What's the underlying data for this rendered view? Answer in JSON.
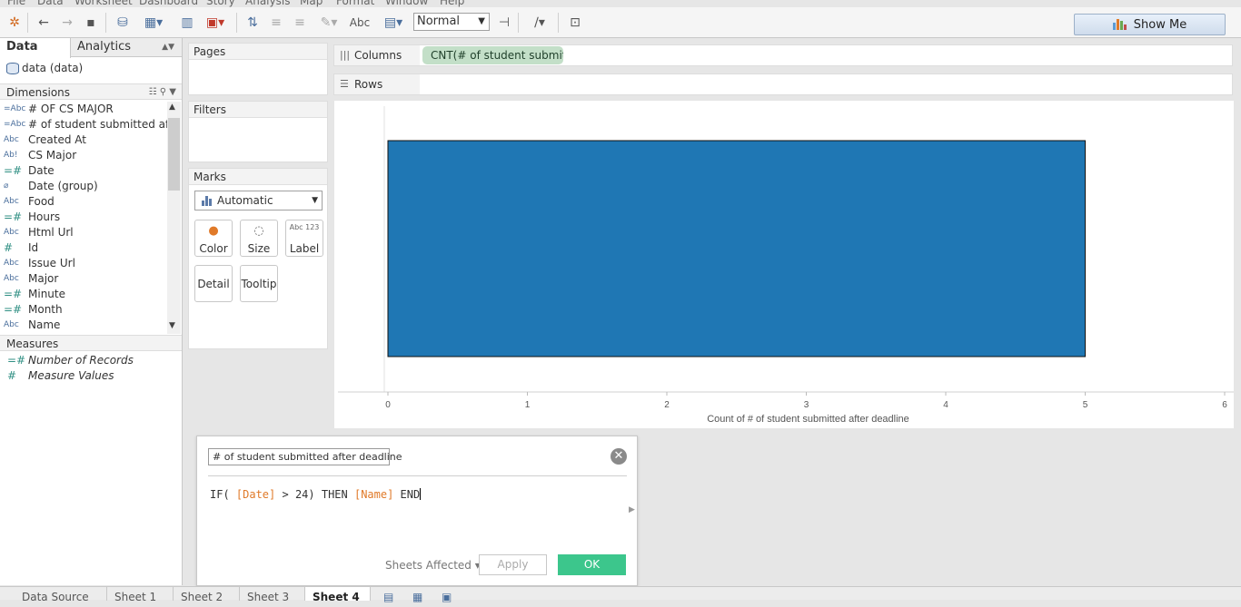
{
  "menu": [
    "File",
    "Data",
    "Worksheet",
    "Dashboard",
    "Story",
    "Analysis",
    "Map",
    "Format",
    "Window",
    "Help"
  ],
  "toolbar": {
    "abc_label": "Abc",
    "fit_select": "Normal",
    "show_me_label": "Show Me",
    "show_me_colors": [
      "#5b9bd5",
      "#e07a29",
      "#6aa84f",
      "#c0504d"
    ]
  },
  "left": {
    "tab_data": "Data",
    "tab_analytics": "Analytics",
    "datasource": "data (data)",
    "dimensions_title": "Dimensions",
    "dimensions": [
      {
        "icon": "=Abc",
        "name": "# OF CS MAJOR"
      },
      {
        "icon": "=Abc",
        "name": "# of student submitted aft..."
      },
      {
        "icon": "Abc",
        "name": "Created At"
      },
      {
        "icon": "Ab!",
        "name": "CS Major"
      },
      {
        "icon": "=#",
        "name": "Date"
      },
      {
        "icon": "clip",
        "name": "Date (group)"
      },
      {
        "icon": "Abc",
        "name": "Food"
      },
      {
        "icon": "=#",
        "name": "Hours"
      },
      {
        "icon": "Abc",
        "name": "Html Url"
      },
      {
        "icon": "#",
        "name": "Id"
      },
      {
        "icon": "Abc",
        "name": "Issue Url"
      },
      {
        "icon": "Abc",
        "name": "Major"
      },
      {
        "icon": "=#",
        "name": "Minute"
      },
      {
        "icon": "=#",
        "name": "Month"
      },
      {
        "icon": "Abc",
        "name": "Name"
      }
    ],
    "measures_title": "Measures",
    "measures": [
      {
        "icon": "=#",
        "name": "Number of Records"
      },
      {
        "icon": "#",
        "name": "Measure Values"
      }
    ]
  },
  "cards": {
    "pages": "Pages",
    "filters": "Filters",
    "marks": "Marks",
    "mark_type": "Automatic",
    "buttons": {
      "color": "Color",
      "size": "Size",
      "label": "Label",
      "detail": "Detail",
      "tooltip": "Tooltip"
    },
    "label_glyph": "Abc 123"
  },
  "shelves": {
    "columns_label": "Columns",
    "columns_pill": "CNT(# of student submit..",
    "rows_label": "Rows"
  },
  "chart_data": {
    "type": "bar",
    "orientation": "horizontal",
    "categories": [
      ""
    ],
    "values": [
      5
    ],
    "xlabel": "Count of # of student submitted after deadline",
    "xlim": [
      0,
      6
    ],
    "xticks": [
      "0",
      "1",
      "2",
      "3",
      "4",
      "5",
      "6"
    ],
    "bar_color": "#1f77b4",
    "grid": false
  },
  "calc": {
    "name": "# of student submitted after deadline",
    "formula": {
      "p1": "IF( ",
      "f1": "[Date]",
      "p2": " > 24) THEN ",
      "f2": "[Name]",
      "p3": " END"
    },
    "sheets_affected": "Sheets Affected",
    "apply": "Apply",
    "ok": "OK"
  },
  "sheets": [
    "Data Source",
    "Sheet 1",
    "Sheet 2",
    "Sheet 3",
    "Sheet 4"
  ]
}
